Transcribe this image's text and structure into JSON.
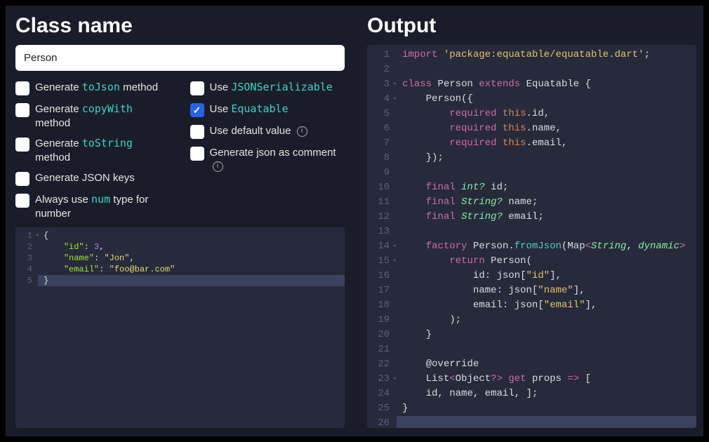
{
  "left": {
    "heading": "Class name",
    "class_name_value": "Person",
    "options_col1": [
      {
        "label_pre": "Generate ",
        "code": "toJson",
        "label_post": " method",
        "checked": false,
        "info": false
      },
      {
        "label_pre": "Generate ",
        "code": "copyWith",
        "label_post": " method",
        "checked": false,
        "info": false
      },
      {
        "label_pre": "Generate ",
        "code": "toString",
        "label_post": " method",
        "checked": false,
        "info": false
      },
      {
        "label_pre": "Generate JSON keys",
        "code": "",
        "label_post": "",
        "checked": false,
        "info": false
      },
      {
        "label_pre": "Always use ",
        "code": "num",
        "label_post": " type for number",
        "checked": false,
        "info": false
      }
    ],
    "options_col2": [
      {
        "label_pre": "Use ",
        "code": "JSONSerializable",
        "label_post": "",
        "checked": false,
        "info": false
      },
      {
        "label_pre": "Use ",
        "code": "Equatable",
        "label_post": "",
        "checked": true,
        "info": false
      },
      {
        "label_pre": "Use default value ",
        "code": "",
        "label_post": "",
        "checked": false,
        "info": true
      },
      {
        "label_pre": "Generate json as comment ",
        "code": "",
        "label_post": "",
        "checked": false,
        "info": true
      }
    ],
    "json_input": {
      "lines": [
        {
          "n": 1,
          "fold": true,
          "html": "<span class='tok-punc'>{</span>"
        },
        {
          "n": 2,
          "fold": false,
          "html": "    <span class='tok-key'>\"id\"</span><span class='tok-punc'>: </span><span class='tok-num'>3</span><span class='tok-punc'>,</span>"
        },
        {
          "n": 3,
          "fold": false,
          "html": "    <span class='tok-key'>\"name\"</span><span class='tok-punc'>: </span><span class='tok-str'>\"Jon\"</span><span class='tok-punc'>,</span>"
        },
        {
          "n": 4,
          "fold": false,
          "html": "    <span class='tok-key'>\"email\"</span><span class='tok-punc'>: </span><span class='tok-str'>\"foo@bar.com\"</span>"
        },
        {
          "n": 5,
          "fold": false,
          "hl": true,
          "html": "<span class='tok-punc'>}</span>"
        }
      ]
    }
  },
  "right": {
    "heading": "Output",
    "code": {
      "lines": [
        {
          "n": 1,
          "fold": false,
          "html": "<span class='tok-kw'>import</span> <span class='tok-str2'>'package:equatable/equatable.dart'</span><span class='tok-punc'>;</span>"
        },
        {
          "n": 2,
          "fold": false,
          "html": ""
        },
        {
          "n": 3,
          "fold": true,
          "html": "<span class='tok-kw'>class</span> <span class='tok-ident'>Person</span> <span class='tok-kw'>extends</span> <span class='tok-ident'>Equatable</span> <span class='tok-punc'>{</span>"
        },
        {
          "n": 4,
          "fold": true,
          "html": "    <span class='tok-ident'>Person</span><span class='tok-punc'>({</span>"
        },
        {
          "n": 5,
          "fold": false,
          "html": "        <span class='tok-kw'>required</span> <span class='tok-this'>this</span><span class='tok-punc'>.</span><span class='tok-ident'>id</span><span class='tok-punc'>,</span>"
        },
        {
          "n": 6,
          "fold": false,
          "html": "        <span class='tok-kw'>required</span> <span class='tok-this'>this</span><span class='tok-punc'>.</span><span class='tok-ident'>name</span><span class='tok-punc'>,</span>"
        },
        {
          "n": 7,
          "fold": false,
          "html": "        <span class='tok-kw'>required</span> <span class='tok-this'>this</span><span class='tok-punc'>.</span><span class='tok-ident'>email</span><span class='tok-punc'>,</span>"
        },
        {
          "n": 8,
          "fold": false,
          "html": "    <span class='tok-punc'>});</span>"
        },
        {
          "n": 9,
          "fold": false,
          "html": ""
        },
        {
          "n": 10,
          "fold": false,
          "html": "    <span class='tok-kw'>final</span> <span class='tok-type'>int?</span> <span class='tok-ident'>id</span><span class='tok-punc'>;</span>"
        },
        {
          "n": 11,
          "fold": false,
          "html": "    <span class='tok-kw'>final</span> <span class='tok-type'>String?</span> <span class='tok-ident'>name</span><span class='tok-punc'>;</span>"
        },
        {
          "n": 12,
          "fold": false,
          "html": "    <span class='tok-kw'>final</span> <span class='tok-type'>String?</span> <span class='tok-ident'>email</span><span class='tok-punc'>;</span>"
        },
        {
          "n": 13,
          "fold": false,
          "html": ""
        },
        {
          "n": 14,
          "fold": true,
          "html": "    <span class='tok-kw'>factory</span> <span class='tok-ident'>Person</span><span class='tok-punc'>.</span><span class='tok-fn'>fromJson</span><span class='tok-punc'>(</span><span class='tok-ident'>Map</span><span class='tok-op'>&lt;</span><span class='tok-type'>String</span><span class='tok-punc'>, </span><span class='tok-type'>dynamic</span><span class='tok-op'>&gt;</span>"
        },
        {
          "n": 15,
          "fold": true,
          "html": "        <span class='tok-kw'>return</span> <span class='tok-ident'>Person</span><span class='tok-punc'>(</span>"
        },
        {
          "n": 16,
          "fold": false,
          "html": "            <span class='tok-ident'>id</span><span class='tok-punc'>:</span> <span class='tok-ident'>json</span><span class='tok-punc'>[</span><span class='tok-str2'>\"id\"</span><span class='tok-punc'>],</span>"
        },
        {
          "n": 17,
          "fold": false,
          "html": "            <span class='tok-ident'>name</span><span class='tok-punc'>:</span> <span class='tok-ident'>json</span><span class='tok-punc'>[</span><span class='tok-str2'>\"name\"</span><span class='tok-punc'>],</span>"
        },
        {
          "n": 18,
          "fold": false,
          "html": "            <span class='tok-ident'>email</span><span class='tok-punc'>:</span> <span class='tok-ident'>json</span><span class='tok-punc'>[</span><span class='tok-str2'>\"email\"</span><span class='tok-punc'>],</span>"
        },
        {
          "n": 19,
          "fold": false,
          "html": "        <span class='tok-punc'>);</span>"
        },
        {
          "n": 20,
          "fold": false,
          "html": "    <span class='tok-punc'>}</span>"
        },
        {
          "n": 21,
          "fold": false,
          "html": ""
        },
        {
          "n": 22,
          "fold": false,
          "html": "    <span class='tok-ident'>@override</span>"
        },
        {
          "n": 23,
          "fold": true,
          "html": "    <span class='tok-ident'>List</span><span class='tok-op'>&lt;</span><span class='tok-ident'>Object</span><span class='tok-op'>?&gt;</span> <span class='tok-kw'>get</span> <span class='tok-ident'>props</span> <span class='tok-op'>=&gt;</span> <span class='tok-punc'>[</span>"
        },
        {
          "n": 24,
          "fold": false,
          "html": "    <span class='tok-ident'>id</span><span class='tok-punc'>,</span> <span class='tok-ident'>name</span><span class='tok-punc'>,</span> <span class='tok-ident'>email</span><span class='tok-punc'>, ];</span>"
        },
        {
          "n": 25,
          "fold": false,
          "html": "<span class='tok-punc'>}</span>"
        },
        {
          "n": 26,
          "fold": false,
          "hl": true,
          "html": ""
        }
      ]
    }
  }
}
